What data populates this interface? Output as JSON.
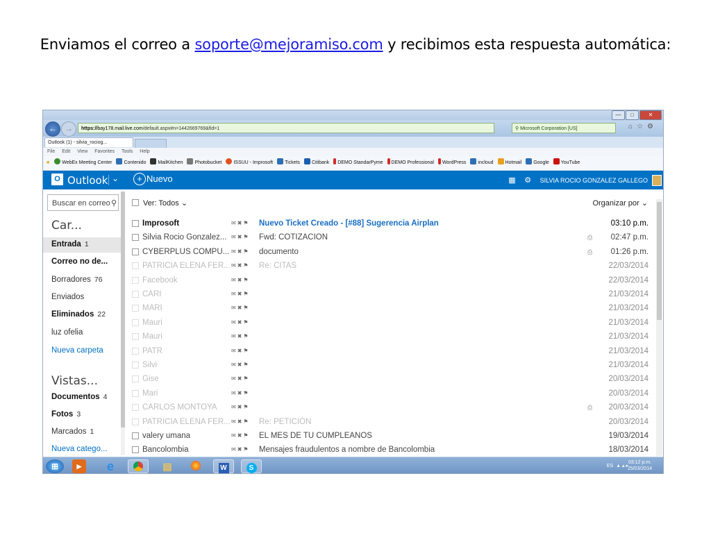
{
  "caption": {
    "before": "Enviamos el correo a ",
    "link": "soporte@mejoramiso.com",
    "after": " y recibimos esta respuesta automática:"
  },
  "browser": {
    "url_prefix": "https://",
    "url_host": "bay178.mail.live.com",
    "url_rest": "/default.aspx#n=1442669769&fid=1",
    "security_label": "Microsoft Corporation [US]",
    "tab_title": "Outlook (1) - silvia_rociog...",
    "menu": [
      "File",
      "Edit",
      "View",
      "Favorites",
      "Tools",
      "Help"
    ],
    "favorites": [
      "WebEx Meeting Center",
      "Contenido",
      "MailKitchen",
      "Photobucket",
      "ISSUU - Improsoft",
      "Tickets",
      "Citibank",
      "DEMO StandarPyme",
      "DEMO Professional",
      "WordPress",
      "incloud",
      "Hotmail",
      "Google",
      "YouTube"
    ],
    "favorite_colors": [
      "#3a8d2d",
      "#2d6fb5",
      "#333333",
      "#555555",
      "#e0521e",
      "#2d6fb5",
      "#1b5fb0",
      "#d12b2b",
      "#d12b2b",
      "#d12b2b",
      "#2d6fb5",
      "#e8a020",
      "#2d6fb5",
      "#cc1111"
    ]
  },
  "outlook": {
    "app_name": "Outlook",
    "new_label": "Nuevo",
    "user_name": "SILVIA ROCIO GONZALEZ GALLEGO",
    "search_placeholder": "Buscar en correo",
    "folders_heading": "Car...",
    "folders": [
      {
        "label": "Entrada",
        "count": "1",
        "bold": true,
        "selected": true
      },
      {
        "label": "Correo no de...",
        "count": "",
        "bold": true
      },
      {
        "label": "Borradores",
        "count": "76",
        "bold": false
      },
      {
        "label": "Enviados",
        "count": "",
        "bold": false
      },
      {
        "label": "Eliminados",
        "count": "22",
        "bold": true
      },
      {
        "label": "luz ofelia",
        "count": "",
        "bold": false
      },
      {
        "label": "Nueva carpeta",
        "count": "",
        "link": true
      }
    ],
    "views_heading": "Vistas...",
    "views": [
      {
        "label": "Documentos",
        "count": "4",
        "bold": true
      },
      {
        "label": "Fotos",
        "count": "3",
        "bold": true
      },
      {
        "label": "Marcados",
        "count": "1",
        "bold": false
      },
      {
        "label": "Nueva catego...",
        "count": "",
        "link": true
      }
    ],
    "filter_label": "Ver: Todos",
    "sort_label": "Organizar por",
    "messages": [
      {
        "sender": "Improsoft",
        "subject": "Nuevo Ticket Creado - [#88] Sugerencia Airplan",
        "date": "03:10 p.m.",
        "state": "unread",
        "attach": false
      },
      {
        "sender": "Silvia Rocio Gonzalez...",
        "subject": "Fwd: COTIZACION",
        "date": "02:47 p.m.",
        "state": "read",
        "attach": true
      },
      {
        "sender": "CYBERPLUS COMPU...",
        "subject": "documento",
        "date": "01:26 p.m.",
        "state": "read",
        "attach": true
      },
      {
        "sender": "PATRICIA ELENA FER...",
        "subject": "Re: CITAS",
        "date": "22/03/2014",
        "state": "faded",
        "attach": false
      },
      {
        "sender": "Facebook",
        "subject": "",
        "date": "22/03/2014",
        "state": "faded",
        "attach": false
      },
      {
        "sender": "CARI",
        "subject": "",
        "date": "21/03/2014",
        "state": "faded",
        "attach": false
      },
      {
        "sender": "MARI",
        "subject": "",
        "date": "21/03/2014",
        "state": "faded",
        "attach": false
      },
      {
        "sender": "Mauri",
        "subject": "",
        "date": "21/03/2014",
        "state": "faded",
        "attach": false
      },
      {
        "sender": "Mauri",
        "subject": "",
        "date": "21/03/2014",
        "state": "faded",
        "attach": false
      },
      {
        "sender": "PATR",
        "subject": "",
        "date": "21/03/2014",
        "state": "faded",
        "attach": false
      },
      {
        "sender": "Silvi",
        "subject": "",
        "date": "21/03/2014",
        "state": "faded",
        "attach": false
      },
      {
        "sender": "Gise",
        "subject": "",
        "date": "20/03/2014",
        "state": "faded",
        "attach": false
      },
      {
        "sender": "Mari",
        "subject": "",
        "date": "20/03/2014",
        "state": "faded",
        "attach": false
      },
      {
        "sender": "CARLOS MONTOYA",
        "subject": "",
        "date": "20/03/2014",
        "state": "faded",
        "attach": true
      },
      {
        "sender": "PATRICIA ELENA FER...",
        "subject": "Re: PETICIÓN",
        "date": "20/03/2014",
        "state": "faded",
        "attach": false
      },
      {
        "sender": "valery umana",
        "subject": "EL MES DE TU CUMPLEANOS",
        "date": "19/03/2014",
        "state": "read",
        "attach": false
      },
      {
        "sender": "Bancolombia",
        "subject": "Mensajes fraudulentos a nombre de Bancolombia",
        "date": "18/03/2014",
        "state": "read",
        "attach": false
      }
    ]
  },
  "taskbar": {
    "apps": [
      "windows-start",
      "media-player",
      "internet-explorer",
      "chrome",
      "file-explorer",
      "firefox",
      "word",
      "skype"
    ],
    "language": "ES",
    "time": "03:12 p.m.",
    "date": "25/03/2014"
  }
}
